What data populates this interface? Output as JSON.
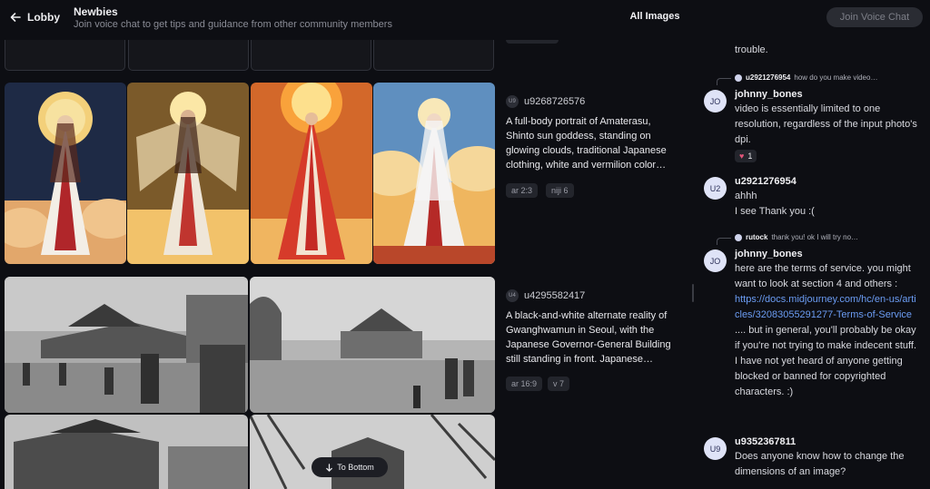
{
  "header": {
    "back_label": "Lobby",
    "channel_title": "Newbies",
    "channel_description": "Join voice chat to get tips and guidance from other community members",
    "view_label": "All Images",
    "join_voice_label": "Join Voice Chat"
  },
  "feed": {
    "to_bottom_label": "To Bottom",
    "posts": [
      {
        "user": "u9268726576",
        "avatar": "U9",
        "prompt": "A full-body portrait of Amaterasu, Shinto sun goddess, standing on glowing clouds, traditional Japanese clothing, white and vermilion color…",
        "params": [
          "ar 2:3",
          "niji 6"
        ]
      },
      {
        "user": "u4295582417",
        "avatar": "U4",
        "prompt": "A black-and-white alternate reality of Gwanghwamun in Seoul, with the Japanese Governor-General Building still standing in front. Japanese…",
        "params": [
          "ar 16:9",
          "v 7"
        ]
      }
    ]
  },
  "chat": {
    "partial_text": "want to check if this is safe to not get in trouble.",
    "messages": [
      {
        "reply_to_user": "u2921276954",
        "reply_to_text": "how do you make video…",
        "avatar": "JO",
        "user": "johnny_bones",
        "text": "video is essentially limited to one resolution, regardless of the input photo's dpi.",
        "reaction_count": "1"
      },
      {
        "avatar": "U2",
        "user": "u2921276954",
        "text_line1": "ahhh",
        "text_line2": "I see Thank you :("
      },
      {
        "reply_to_user": "rutock",
        "reply_to_text": "thank you! ok I will try no…",
        "avatar": "JO",
        "user": "johnny_bones",
        "text_before_link": "here are the terms of service. you might want to look at section 4 and others :",
        "link": "https://docs.midjourney.com/hc/en-us/articles/32083055291277-Terms-of-Service",
        "text_after_link_1": ".... but in general, you'll probably be okay if you're not trying to make indecent stuff.",
        "text_after_link_2": "I have not yet heard of anyone getting blocked or banned for copyrighted characters. :)"
      },
      {
        "avatar": "U9",
        "user": "u9352367811",
        "text": "Does anyone know how to change the dimensions of an image?"
      }
    ]
  },
  "icons": [
    "arrow-left-icon",
    "arrow-down-icon",
    "heart-icon"
  ],
  "colors": {
    "background": "#0d0e13",
    "link": "#6b9cf3",
    "chip": "#23252c",
    "avatar": "#dfe3f7"
  }
}
